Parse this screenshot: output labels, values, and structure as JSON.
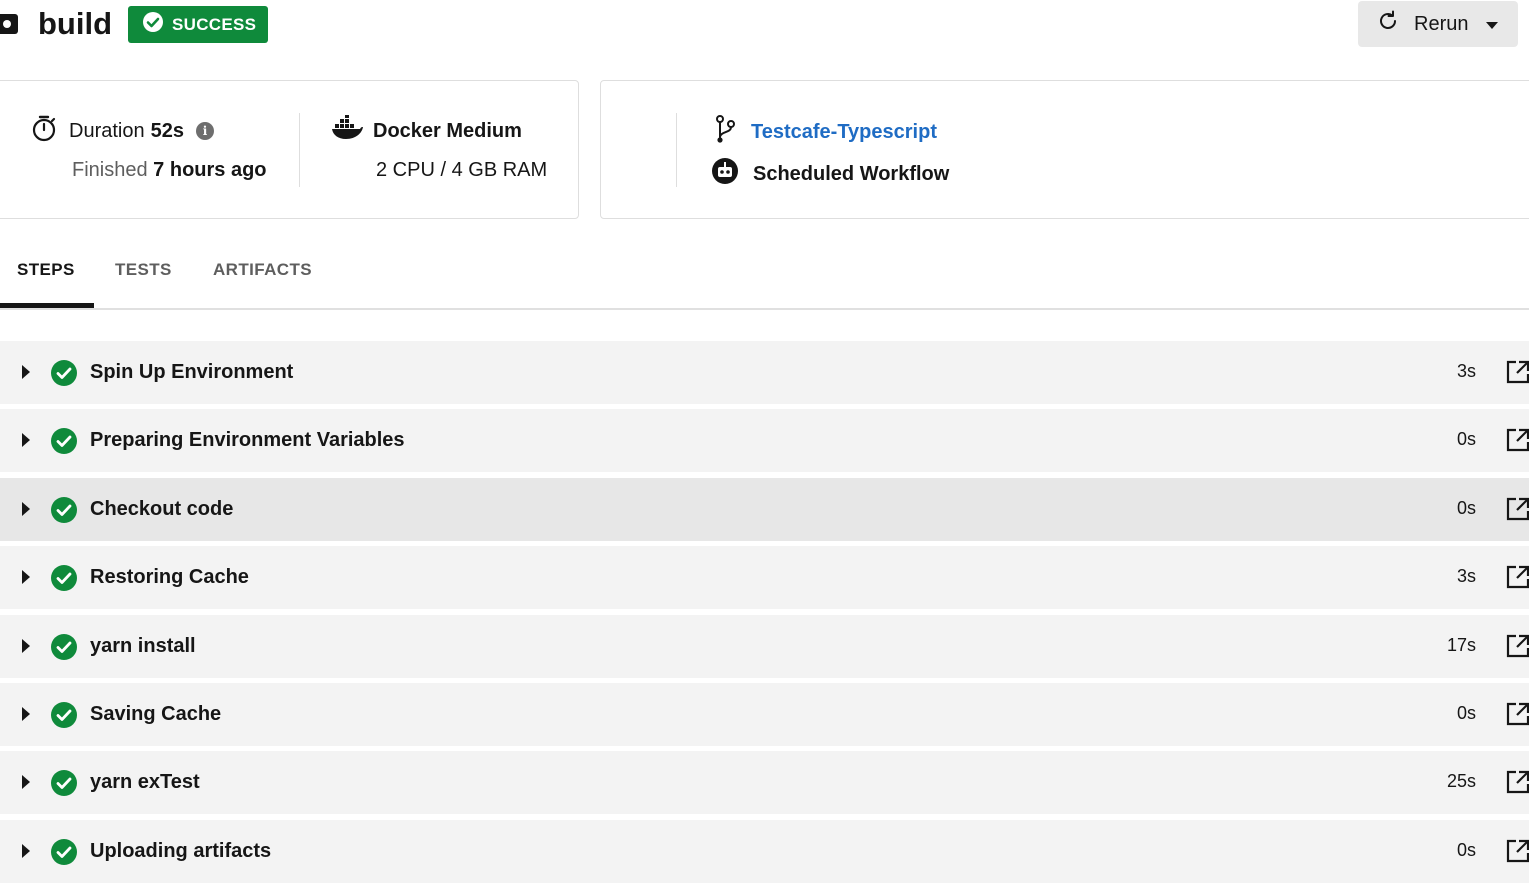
{
  "header": {
    "job_title": "build",
    "status": "SUCCESS",
    "status_color": "#0f8a3b",
    "rerun_label": "Rerun"
  },
  "summary": {
    "duration_label": "Duration",
    "duration_value": "52s",
    "finished_label": "Finished",
    "finished_value": "7 hours ago",
    "executor_name": "Docker Medium",
    "executor_spec": "2 CPU / 4 GB RAM",
    "branch_name": "Testcafe-Typescript",
    "trigger": "Scheduled Workflow"
  },
  "tabs": [
    {
      "label": "STEPS",
      "active": true
    },
    {
      "label": "TESTS",
      "active": false
    },
    {
      "label": "ARTIFACTS",
      "active": false
    }
  ],
  "steps": [
    {
      "name": "Spin Up Environment",
      "duration": "3s"
    },
    {
      "name": "Preparing Environment Variables",
      "duration": "0s"
    },
    {
      "name": "Checkout code",
      "duration": "0s"
    },
    {
      "name": "Restoring Cache",
      "duration": "3s"
    },
    {
      "name": "yarn install",
      "duration": "17s"
    },
    {
      "name": "Saving Cache",
      "duration": "0s"
    },
    {
      "name": "yarn exTest",
      "duration": "25s"
    },
    {
      "name": "Uploading artifacts",
      "duration": "0s"
    }
  ],
  "icons": {
    "job": "job-square-icon",
    "status": "check-circle-icon",
    "rerun": "refresh-icon",
    "dropdown": "caret-down-icon",
    "duration": "stopwatch-icon",
    "info": "info-icon",
    "executor": "docker-icon",
    "branch": "git-branch-icon",
    "trigger": "robot-icon",
    "step_expand": "caret-right-icon",
    "step_status": "check-circle-icon",
    "step_open": "external-link-icon"
  }
}
